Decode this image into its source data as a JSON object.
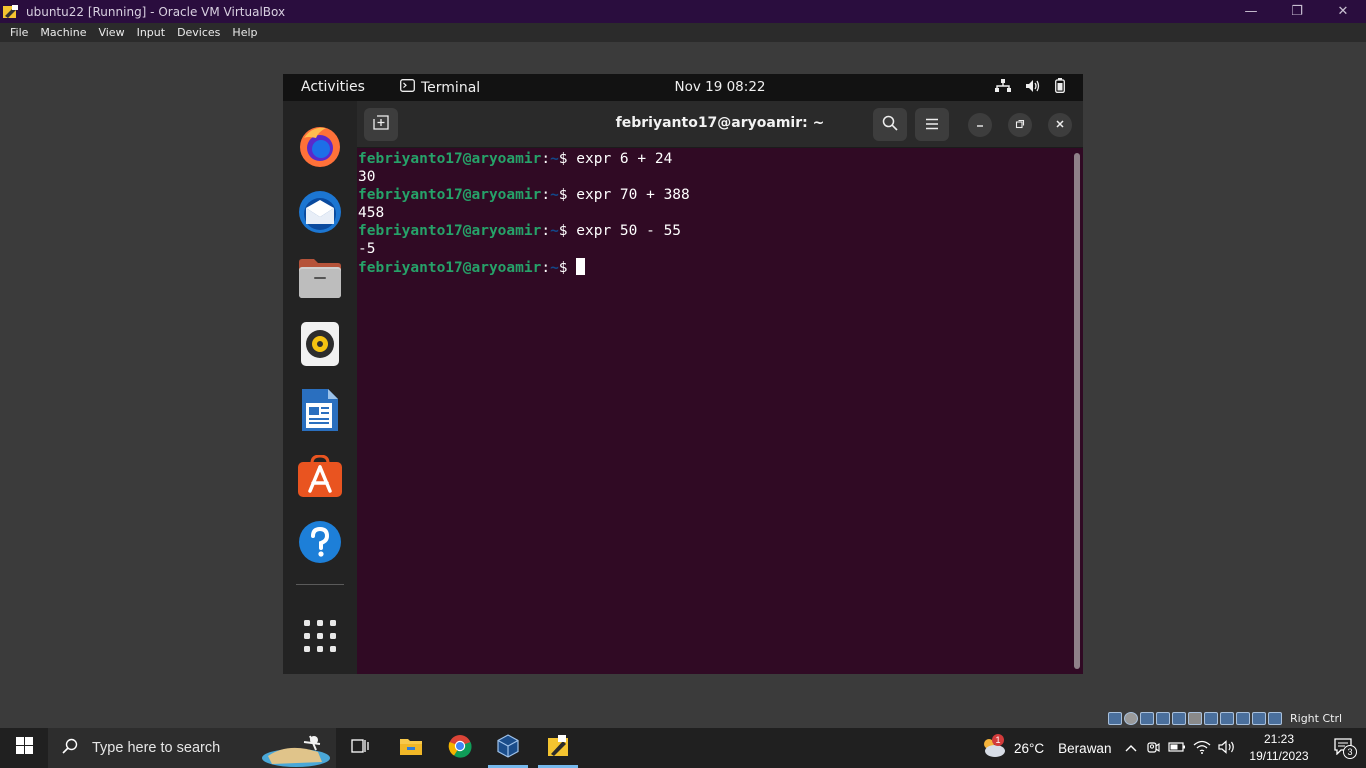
{
  "host": {
    "window_title": "ubuntu22 [Running] - Oracle VM VirtualBox",
    "window_controls": {
      "minimize": "—",
      "restore": "❐",
      "close": "✕"
    },
    "menu": [
      "File",
      "Machine",
      "View",
      "Input",
      "Devices",
      "Help"
    ],
    "status_right": "Right Ctrl"
  },
  "gnome": {
    "activities": "Activities",
    "app_name": "Terminal",
    "clock": "Nov 19  08:22",
    "dock_icons": [
      "firefox-icon",
      "thunderbird-icon",
      "files-icon",
      "rhythmbox-icon",
      "libreoffice-writer-icon",
      "ubuntu-software-icon",
      "help-icon",
      "show-apps-icon"
    ]
  },
  "terminal": {
    "title": "febriyanto17@aryoamir: ~",
    "prompt_user": "febriyanto17@aryoamir",
    "prompt_sep": ":",
    "prompt_path": "~",
    "prompt_end": "$ ",
    "lines": [
      {
        "type": "prompt",
        "cmd": "expr 6 + 24"
      },
      {
        "type": "output",
        "text": "30"
      },
      {
        "type": "prompt",
        "cmd": "expr 70 + 388"
      },
      {
        "type": "output",
        "text": "458"
      },
      {
        "type": "prompt",
        "cmd": "expr 50 - 55"
      },
      {
        "type": "output",
        "text": "-5"
      },
      {
        "type": "prompt",
        "cmd": ""
      }
    ]
  },
  "taskbar": {
    "search_placeholder": "Type here to search",
    "weather_temp": "26°C",
    "weather_desc": "Berawan",
    "time": "21:23",
    "date": "19/11/2023",
    "notification_count": "3",
    "weather_badge": "1"
  },
  "colors": {
    "terminal_bg": "#300a24",
    "prompt_user": "#26a269",
    "prompt_path": "#12488b",
    "vbox_titlebar": "#2a0d3e"
  }
}
